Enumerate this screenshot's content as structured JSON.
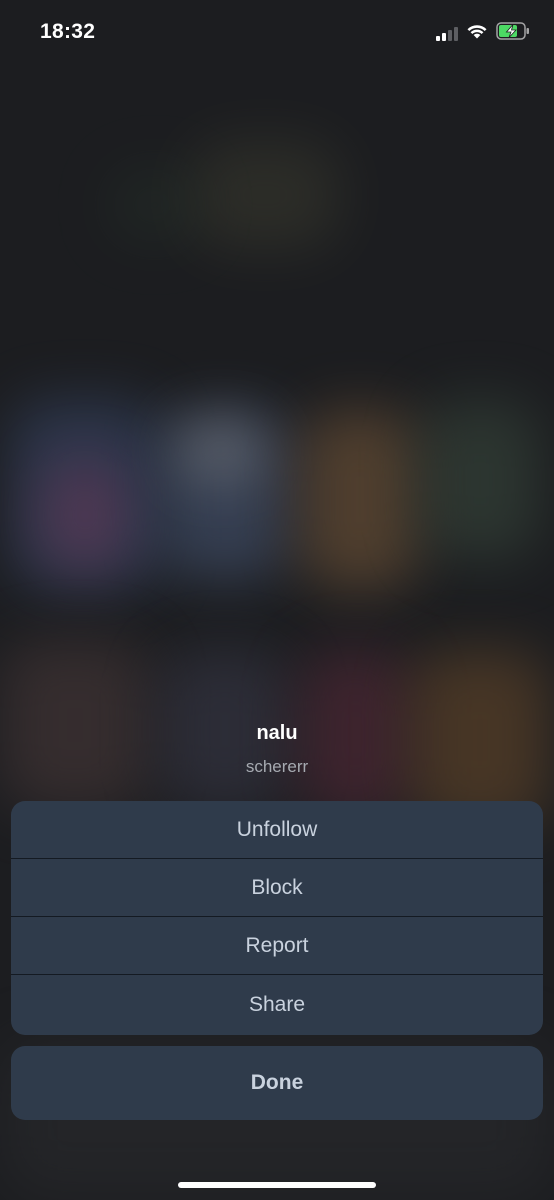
{
  "status_bar": {
    "time": "18:32",
    "icons": [
      "cellular-signal-icon",
      "wifi-icon",
      "battery-charging-icon"
    ],
    "battery_color": "#4cd964"
  },
  "action_sheet": {
    "title": "nalu",
    "subtitle": "schererr",
    "actions": [
      {
        "label": "Unfollow"
      },
      {
        "label": "Block"
      },
      {
        "label": "Report"
      },
      {
        "label": "Share"
      }
    ],
    "done_label": "Done"
  },
  "colors": {
    "sheet_background": "#2f3b4b",
    "sheet_text": "#c9d2de",
    "backdrop": "#1c1d20"
  }
}
